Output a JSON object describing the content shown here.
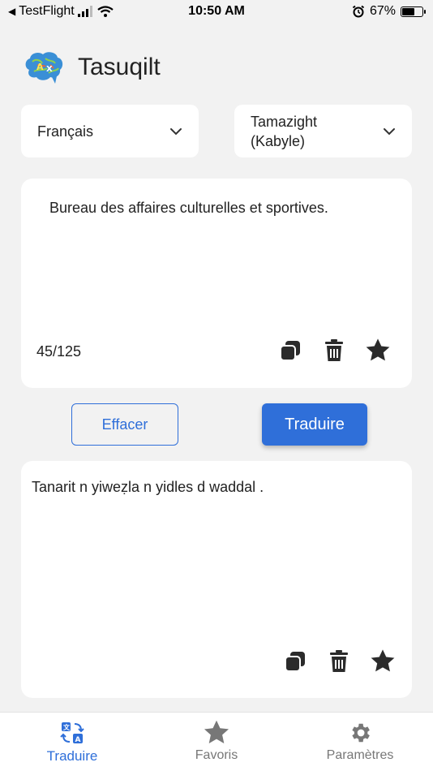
{
  "status_bar": {
    "back_app": "TestFlight",
    "time": "10:50 AM",
    "battery_percent": "67%",
    "battery_level": 0.67
  },
  "header": {
    "app_title": "Tasuqilt",
    "logo_icon": "brain-logo-icon"
  },
  "languages": {
    "source": "Français",
    "target_line1": "Tamazight",
    "target_line2": "(Kabyle)"
  },
  "source": {
    "text": "Bureau des affaires culturelles et sportives.",
    "char_count": "45/125"
  },
  "actions": {
    "clear_label": "Effacer",
    "translate_label": "Traduire"
  },
  "target": {
    "text": "Tanarit n yiweẓla n yidles d waddal ."
  },
  "nav": {
    "translate": "Traduire",
    "favorites": "Favoris",
    "settings": "Paramètres"
  },
  "colors": {
    "accent": "#2f6fd9",
    "background": "#f2f2f2",
    "card": "#ffffff",
    "icon_dark": "#2b2b2b",
    "nav_inactive": "#777777"
  }
}
